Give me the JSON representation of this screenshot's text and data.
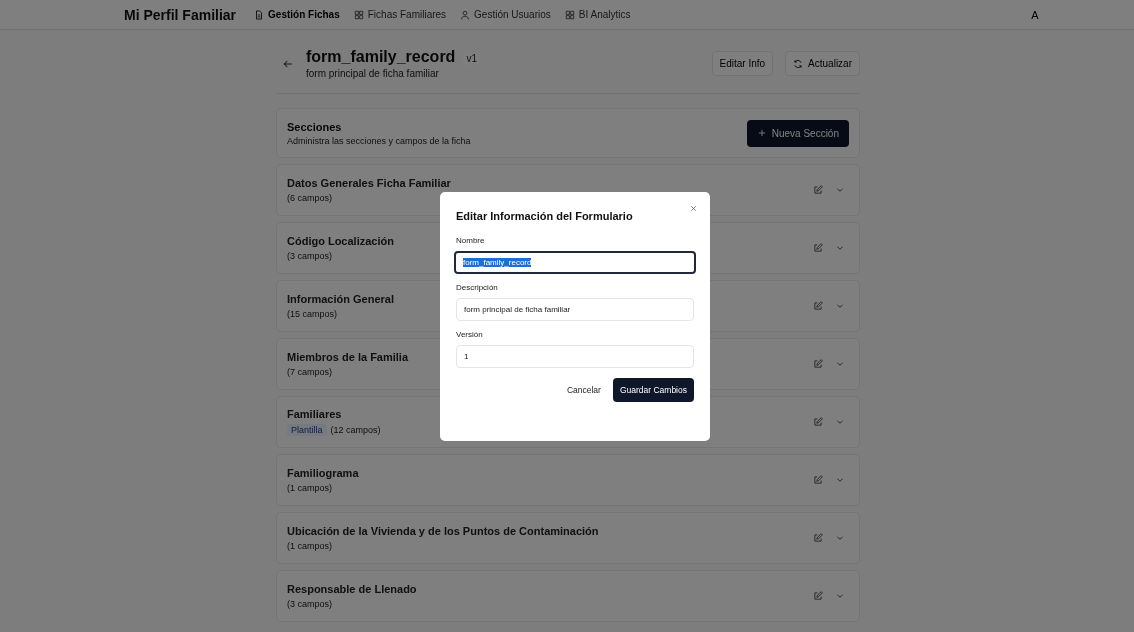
{
  "nav": {
    "brand": "Mi Perfil Familiar",
    "items": [
      {
        "label": "Gestión Fichas",
        "selected": true
      },
      {
        "label": "Fichas Familiares",
        "selected": false
      },
      {
        "label": "Gestión Usuarios",
        "selected": false
      },
      {
        "label": "BI Analytics",
        "selected": false
      }
    ],
    "avatar": "A"
  },
  "header": {
    "title": "form_family_record",
    "version": "v1",
    "subtitle": "form principal de ficha familiar",
    "buttons": [
      "Editar Info",
      "Actualizar"
    ]
  },
  "sections_card": {
    "title": "Secciones",
    "subtitle": "Administra las secciones y campos de la ficha",
    "button": "Nueva Sección"
  },
  "sections": [
    {
      "title": "Datos Generales Ficha Familiar",
      "count": "(6 campos)"
    },
    {
      "title": "Código Localización",
      "count": "(3 campos)"
    },
    {
      "title": "Información General",
      "count": "(15 campos)"
    },
    {
      "title": "Miembros de la Familia",
      "count": "(7 campos)"
    },
    {
      "title": "Familiares",
      "badge": "Plantilla",
      "count": "(12 campos)"
    },
    {
      "title": "Familiograma",
      "count": "(1 campos)"
    },
    {
      "title": "Ubicación de la Vivienda y de los Puntos de Contaminación",
      "count": "(1 campos)"
    },
    {
      "title": "Responsable de Llenado",
      "count": "(3 campos)"
    }
  ],
  "dialog": {
    "title": "Editar Información del Formulario",
    "fields": [
      {
        "label": "Nombre",
        "value": "form_family_record",
        "focused": true,
        "text_selected": true
      },
      {
        "label": "Descripción",
        "value": "form principal de ficha familiar",
        "focused": false,
        "text_selected": false
      },
      {
        "label": "Versión",
        "value": "1",
        "focused": false,
        "text_selected": false
      }
    ],
    "cancel": "Cancelar",
    "submit": "Guardar Cambios"
  }
}
